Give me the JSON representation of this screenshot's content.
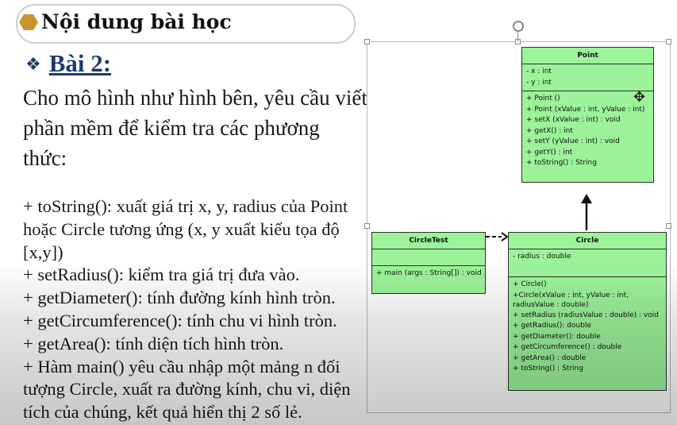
{
  "header": {
    "title": "Nội dung bài học"
  },
  "lesson": {
    "title": "Bài 2:"
  },
  "intro": [
    "Cho mô hình như hình bên, yêu cầu viết",
    "phần mềm để kiểm tra các phương",
    "thức:"
  ],
  "bullets": [
    "+ toString(): xuất giá trị x, y, radius của Point",
    "hoặc Circle tương ứng (x, y xuất kiểu tọa độ",
    "[x,y])",
    "+ setRadius(): kiểm tra giá trị đưa vào.",
    "+ getDiameter(): tính đường kính hình tròn.",
    "+ getCircumference(): tính chu vi hình tròn.",
    "+ getArea(): tính diện tích hình tròn.",
    "+ Hàm main() yêu cầu nhập một mảng n đối",
    "tượng Circle, xuất ra đường kính, chu vi, diện",
    "tích của chúng, kết quả hiển thị 2 số lẻ."
  ],
  "diagram": {
    "point": {
      "name": "Point",
      "attributes": [
        "- x : int",
        "- y : int"
      ],
      "methods": [
        "+ Point ()",
        "+ Point (xValue : int, yValue : int)",
        "+ setX (xValue : int) : void",
        "+ getX() : int",
        "+ setY (yValue : int) : void",
        "+ getY() : int",
        "+ toString() : String"
      ]
    },
    "circle_test": {
      "name": "CircleTest",
      "methods": [
        "+ main (args : String[]) : void"
      ]
    },
    "circle": {
      "name": "Circle",
      "attributes": [
        "- radius : double"
      ],
      "methods": [
        "+ Circle()",
        "+Circle(xValue : int, yValue : int, radiusValue : double)",
        "+ setRadius (radiusValue : double) : void",
        "+ getRadius(): double",
        "+ getDiameter(): double",
        "+ getCircumference() : double",
        "+ getArea() : double",
        "+ toString() : String"
      ]
    }
  },
  "colors": {
    "uml_fill": "#9cf39a",
    "lesson_title": "#1f3b6e",
    "hexagon": "#c9962b"
  }
}
